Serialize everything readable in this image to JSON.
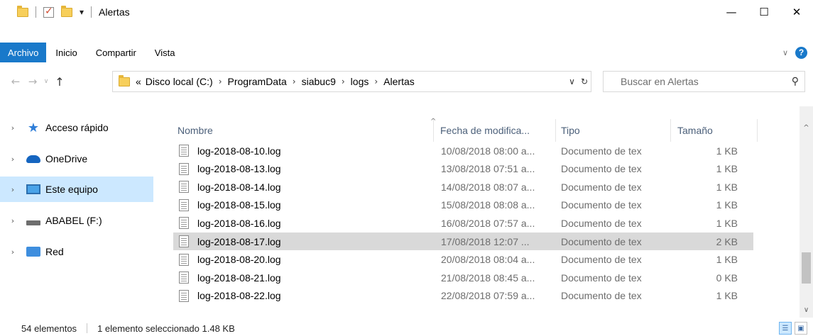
{
  "window": {
    "title": "Alertas",
    "minimize": "—",
    "maximize": "☐",
    "close": "✕"
  },
  "ribbon": {
    "tabs": [
      {
        "label": "Archivo",
        "active": true
      },
      {
        "label": "Inicio"
      },
      {
        "label": "Compartir"
      },
      {
        "label": "Vista"
      }
    ]
  },
  "address": {
    "overflow": "«",
    "crumbs": [
      "Disco local (C:)",
      "ProgramData",
      "siabuc9",
      "logs",
      "Alertas"
    ],
    "refresh": "↻",
    "dropdown": "∨"
  },
  "search": {
    "placeholder": "Buscar en Alertas"
  },
  "navpane": {
    "items": [
      {
        "label": "Acceso rápido",
        "icon": "star-icon"
      },
      {
        "label": "OneDrive",
        "icon": "cloud-icon"
      },
      {
        "label": "Este equipo",
        "icon": "pc-icon",
        "selected": true
      },
      {
        "label": "ABABEL (F:)",
        "icon": "drive-icon"
      },
      {
        "label": "Red",
        "icon": "network-icon"
      }
    ]
  },
  "columns": {
    "name": "Nombre",
    "date": "Fecha de modifica...",
    "type": "Tipo",
    "size": "Tamaño"
  },
  "files": [
    {
      "name": "log-2018-08-10.log",
      "date": "10/08/2018 08:00 a...",
      "type": "Documento de tex",
      "size": "1 KB"
    },
    {
      "name": "log-2018-08-13.log",
      "date": "13/08/2018 07:51 a...",
      "type": "Documento de tex",
      "size": "1 KB"
    },
    {
      "name": "log-2018-08-14.log",
      "date": "14/08/2018 08:07 a...",
      "type": "Documento de tex",
      "size": "1 KB"
    },
    {
      "name": "log-2018-08-15.log",
      "date": "15/08/2018 08:08 a...",
      "type": "Documento de tex",
      "size": "1 KB"
    },
    {
      "name": "log-2018-08-16.log",
      "date": "16/08/2018 07:57 a...",
      "type": "Documento de tex",
      "size": "1 KB"
    },
    {
      "name": "log-2018-08-17.log",
      "date": "17/08/2018 12:07 ...",
      "type": "Documento de tex",
      "size": "2 KB",
      "selected": true
    },
    {
      "name": "log-2018-08-20.log",
      "date": "20/08/2018 08:04 a...",
      "type": "Documento de tex",
      "size": "1 KB"
    },
    {
      "name": "log-2018-08-21.log",
      "date": "21/08/2018 08:45 a...",
      "type": "Documento de tex",
      "size": "0 KB"
    },
    {
      "name": "log-2018-08-22.log",
      "date": "22/08/2018 07:59 a...",
      "type": "Documento de tex",
      "size": "1 KB"
    }
  ],
  "status": {
    "count": "54 elementos",
    "selection": "1 elemento seleccionado  1.48 KB"
  }
}
